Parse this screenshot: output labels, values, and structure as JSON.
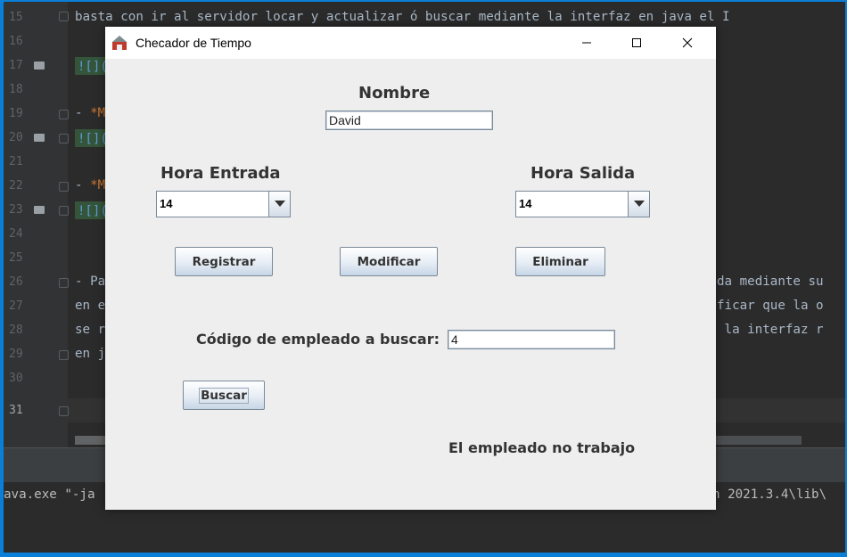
{
  "editor": {
    "line_numbers": [
      "15",
      "16",
      "17",
      "18",
      "19",
      "20",
      "21",
      "22",
      "23",
      "24",
      "25",
      "26",
      "27",
      "28",
      "29",
      "30",
      "31"
    ],
    "line15_text": "basta con ir al servidor locar y actualizar ó buscar mediante la interfaz en java el I",
    "img_link": "![](",
    "line19_prefix": "- ",
    "line19_star": "*M",
    "line22_prefix": "- ",
    "line22_star": "*M",
    "line26_left": "- Pa",
    "line26_right": "da mediante su",
    "line27_left": "en e",
    "line27_right": "ficar que la o",
    "line28_left": "se r",
    "line28_right": " la interfaz r",
    "line29_left": "en j",
    "console_left": "ava.exe \"-ja",
    "console_right": "n 2021.3.4\\lib\\"
  },
  "window": {
    "title": "Checador de Tiempo",
    "minimize_glyph": "—",
    "close_glyph": "✕"
  },
  "form": {
    "nombre_label": "Nombre",
    "nombre_value": "David",
    "hora_entrada_label": "Hora Entrada",
    "hora_entrada_value": "14",
    "hora_salida_label": "Hora Salida",
    "hora_salida_value": "14",
    "registrar_label": "Registrar",
    "modificar_label": "Modificar",
    "eliminar_label": "Eliminar",
    "codigo_label": "Código de empleado a buscar:",
    "codigo_value": "4",
    "buscar_label": "Buscar",
    "status_message": "El empleado no trabajo"
  }
}
